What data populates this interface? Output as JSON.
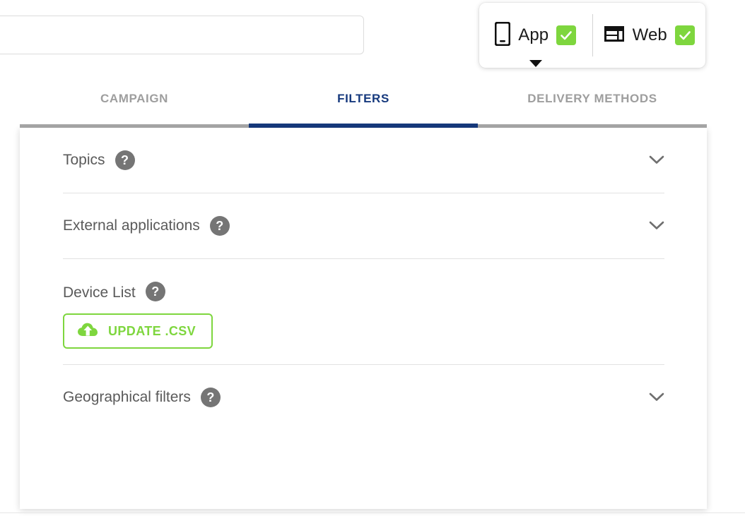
{
  "campaign_name_field": {
    "value": "",
    "placeholder": ""
  },
  "channel_panel": {
    "options": [
      {
        "label": "App",
        "icon": "mobile-phone-icon",
        "checked": true
      },
      {
        "label": "Web",
        "icon": "browser-window-icon",
        "checked": true
      }
    ],
    "checkbox_color": "#7ed63e",
    "caret": "dropdown-caret"
  },
  "tabs": [
    {
      "label": "CAMPAIGN",
      "active": false
    },
    {
      "label": "FILTERS",
      "active": true
    },
    {
      "label": "DELIVERY METHODS",
      "active": false
    }
  ],
  "tab_colors": {
    "active": "#16397d",
    "inactive": "#9e9e9e",
    "track": "#a8a8a8"
  },
  "filters": [
    {
      "title": "Topics",
      "help": "?",
      "expanded": false,
      "control": "chevron-down"
    },
    {
      "title": "External applications",
      "help": "?",
      "expanded": false,
      "control": "chevron-down"
    },
    {
      "title": "Device List",
      "help": "?",
      "expanded": true,
      "control": "upload-button",
      "upload_button": {
        "label": "UPDATE .CSV",
        "icon": "cloud-upload-icon",
        "color": "#7ed63e"
      }
    },
    {
      "title": "Geographical filters",
      "help": "?",
      "expanded": false,
      "control": "chevron-down"
    }
  ]
}
